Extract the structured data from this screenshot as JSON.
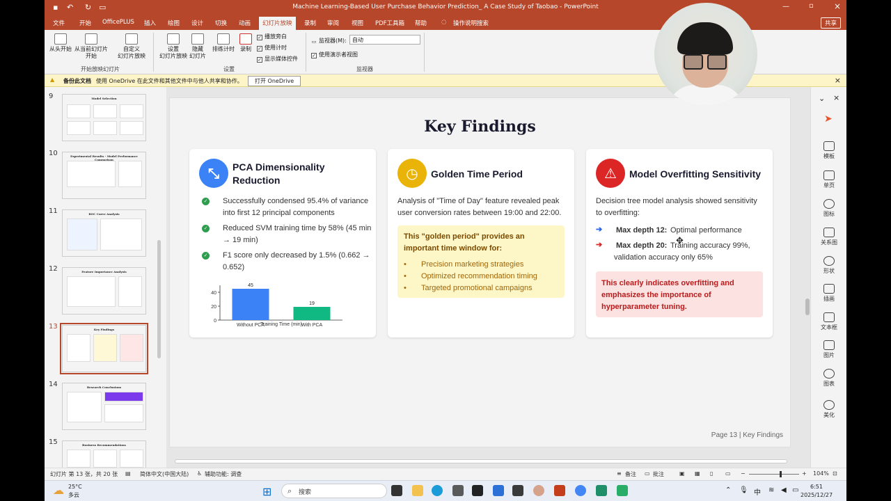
{
  "app": {
    "title": "Machine Learning-Based User Purchase Behavior Prediction_ A Case Study of Taobao  -  PowerPoint",
    "share": "共享",
    "tabs": [
      "文件",
      "开始",
      "OfficePLUS",
      "插入",
      "绘图",
      "设计",
      "切换",
      "动画",
      "幻灯片放映",
      "录制",
      "审阅",
      "视图",
      "PDF工具箱",
      "帮助",
      "操作说明搜索"
    ],
    "active_tab": "幻灯片放映"
  },
  "ribbon": {
    "from_start": "从头开始",
    "from_current_l1": "从当前幻灯片",
    "from_current_l2": "开始",
    "custom_l1": "自定义",
    "custom_l2": "幻灯片放映",
    "group_start": "开始放映幻灯片",
    "setup_l1": "设置",
    "setup_l2": "幻灯片放映",
    "hide_l1": "隐藏",
    "hide_l2": "幻灯片",
    "timing": "排练计时",
    "record": "录制",
    "chk_narration": "播放旁白",
    "chk_timing": "使用计时",
    "chk_media": "显示媒体控件",
    "group_setup": "设置",
    "monitor_label": "监视器(M):",
    "monitor_value": "自动",
    "presenter_view": "使用演示者视图",
    "group_monitor": "监视器"
  },
  "notice": {
    "title": "备份此文档",
    "text": "使用 OneDrive 在此文件和其他文件中与他人共享和协作。",
    "button": "打开 OneDrive"
  },
  "thumbnails": [
    {
      "num": "9",
      "title": "Model Selection"
    },
    {
      "num": "10",
      "title": "Experimental Results - Model Performance Comparison"
    },
    {
      "num": "11",
      "title": "ROC Curve Analysis"
    },
    {
      "num": "12",
      "title": "Feature Importance Analysis"
    },
    {
      "num": "13",
      "title": "Key Findings"
    },
    {
      "num": "14",
      "title": "Research Conclusions"
    },
    {
      "num": "15",
      "title": "Business Recommendations"
    }
  ],
  "slide": {
    "title": "Key Findings",
    "footer": "Page 13 | Key Findings",
    "card1": {
      "title_l1": "PCA Dimensionality",
      "title_l2": "Reduction",
      "b1_l1": "Successfully condensed 95.4% of variance",
      "b1_l2": "into first 12 principal components",
      "b2_l1": "Reduced SVM training time by 58% (45 min",
      "b2_l2": "→ 19 min)",
      "b3_l1": "F1 score only decreased by 1.5% (0.662 →",
      "b3_l2": "0.652)"
    },
    "card2": {
      "title": "Golden Time Period",
      "p_l1": "Analysis of \"Time of Day\" feature revealed peak",
      "p_l2": "user conversion rates between 19:00 and 22:00.",
      "box_l1": "This \"golden period\" provides an",
      "box_l2": "important time window for:",
      "items": [
        "Precision marketing strategies",
        "Optimized recommendation timing",
        "Targeted promotional campaigns"
      ]
    },
    "card3": {
      "title": "Model Overfitting Sensitivity",
      "p_l1": "Decision tree model analysis showed sensitivity",
      "p_l2": "to overfitting:",
      "d12_label": "Max depth 12:",
      "d12_text": "Optimal performance",
      "d20_label": "Max depth 20:",
      "d20_text": "Training accuracy 99%,",
      "d20_l2": "validation accuracy only 65%",
      "warn_l1": "This clearly indicates overfitting and",
      "warn_l2": "emphasizes the importance of",
      "warn_l3": "hyperparameter tuning."
    }
  },
  "chart_data": {
    "type": "bar",
    "categories": [
      "Without PCA",
      "With PCA"
    ],
    "values": [
      45,
      19
    ],
    "xlabel": "Training Time (min)",
    "ylim": [
      0,
      50
    ],
    "yticks": [
      0,
      20,
      40
    ],
    "colors": [
      "#3b82f6",
      "#10b981"
    ]
  },
  "sidepanel": [
    "模板",
    "单页",
    "图标",
    "关系图",
    "形状",
    "插画",
    "文本框",
    "图片",
    "图表",
    "美化"
  ],
  "status": {
    "slide_info": "幻灯片 第 13 张，共 20 张",
    "language": "简体中文(中国大陆)",
    "accessibility": "辅助功能: 调查",
    "notes": "备注",
    "comments": "批注",
    "zoom": "104%"
  },
  "taskbar": {
    "temp": "25°C",
    "weather": "多云",
    "search": "搜索",
    "ime": "中",
    "time": "6:51",
    "date": "2025/12/27"
  }
}
